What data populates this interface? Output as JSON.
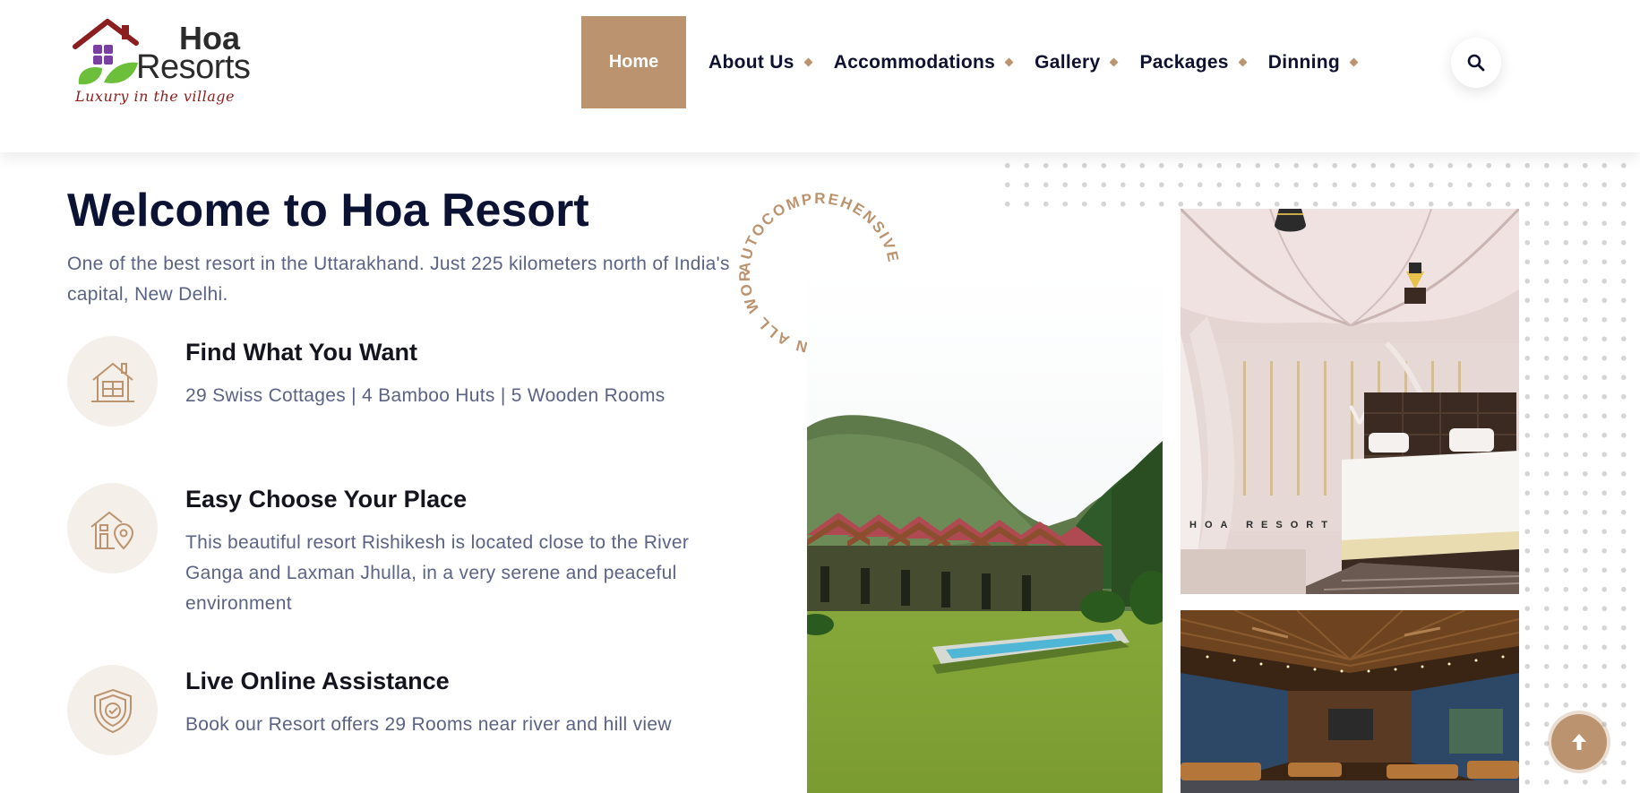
{
  "brand": {
    "name_line1": "Hoa",
    "name_line2": "Resorts",
    "tagline": "Luxury in the village"
  },
  "nav": {
    "items": [
      {
        "label": "Home",
        "active": true
      },
      {
        "label": "About Us",
        "active": false
      },
      {
        "label": "Accommodations",
        "active": false
      },
      {
        "label": "Gallery",
        "active": false
      },
      {
        "label": "Packages",
        "active": false
      },
      {
        "label": "Dinning",
        "active": false
      }
    ],
    "search_icon": "search-icon"
  },
  "welcome": {
    "title": "Welcome to Hoa Resort",
    "text": "One of the best resort in the Uttarakhand. Just 225 kilometers north of India's capital, New Delhi."
  },
  "features": [
    {
      "icon": "house-icon",
      "title": "Find What You Want",
      "text": "29 Swiss Cottages | 4 Bamboo Huts | 5 Wooden Rooms"
    },
    {
      "icon": "house-location-icon",
      "title": "Easy Choose Your Place",
      "text": "This beautiful resort Rishikesh is located close to the River Ganga and Laxman Jhulla, in a very serene and peaceful environment"
    },
    {
      "icon": "shield-check-icon",
      "title": "Live Online Assistance",
      "text": "Book our Resort offers 29 Rooms near river and hill view"
    }
  ],
  "circle_badge": {
    "text": "AUTOCOMPREHENSIVE WARRANTY ON ALL WORK IN"
  },
  "gallery": {
    "tent_watermark": "HOA RESORT"
  },
  "colors": {
    "accent": "#bb936e",
    "heading": "#0b1233",
    "body_text": "#5b6385",
    "icon_bg": "#f5efe9"
  }
}
